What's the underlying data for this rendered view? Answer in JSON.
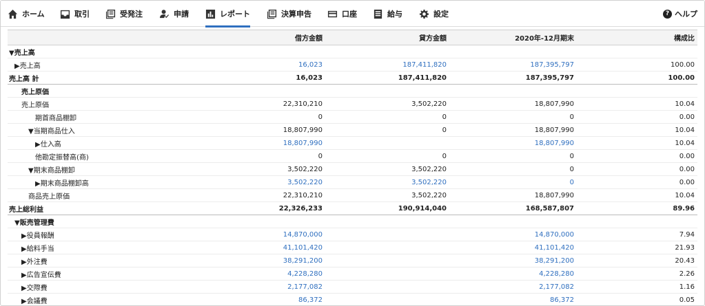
{
  "nav": {
    "items": [
      {
        "label": "ホーム",
        "icon": "home-icon"
      },
      {
        "label": "取引",
        "icon": "inbox-icon"
      },
      {
        "label": "受発注",
        "icon": "document-icon"
      },
      {
        "label": "申請",
        "icon": "user-check-icon"
      },
      {
        "label": "レポート",
        "icon": "bar-chart-icon",
        "active": true
      },
      {
        "label": "決算申告",
        "icon": "document-icon"
      },
      {
        "label": "口座",
        "icon": "credit-card-icon"
      },
      {
        "label": "給与",
        "icon": "list-icon"
      },
      {
        "label": "設定",
        "icon": "gear-icon"
      }
    ],
    "help_label": "ヘルプ",
    "help_icon": "?",
    "accent_color": "#2f6fbf"
  },
  "table": {
    "headers": [
      "",
      "借方金額",
      "貸方金額",
      "2020年-12月期末",
      "構成比"
    ],
    "rows": [
      {
        "name": "▼売上高",
        "level": 0,
        "style": "bold",
        "debit": "",
        "credit": "",
        "period": "",
        "ratio": "",
        "link": false
      },
      {
        "name": "▶売上高",
        "level": 1,
        "style": "",
        "debit": "16,023",
        "credit": "187,411,820",
        "period": "187,395,797",
        "ratio": "100.00",
        "link": true
      },
      {
        "name": "売上高 計",
        "level": 0,
        "style": "total",
        "debit": "16,023",
        "credit": "187,411,820",
        "period": "187,395,797",
        "ratio": "100.00",
        "link": false
      },
      {
        "name": "売上原価",
        "level": 2,
        "style": "bold",
        "debit": "",
        "credit": "",
        "period": "",
        "ratio": "",
        "link": false
      },
      {
        "name": "売上原価",
        "level": 2,
        "style": "",
        "debit": "22,310,210",
        "credit": "3,502,220",
        "period": "18,807,990",
        "ratio": "10.04",
        "link": false
      },
      {
        "name": "期首商品棚卸",
        "level": 4,
        "style": "",
        "debit": "0",
        "credit": "0",
        "period": "0",
        "ratio": "0.00",
        "link": false
      },
      {
        "name": "▼当期商品仕入",
        "level": 3,
        "style": "",
        "debit": "18,807,990",
        "credit": "0",
        "period": "18,807,990",
        "ratio": "10.04",
        "link": false
      },
      {
        "name": "▶仕入高",
        "level": 4,
        "style": "",
        "debit": "18,807,990",
        "credit": "",
        "period": "18,807,990",
        "ratio": "10.04",
        "link": true
      },
      {
        "name": "他勘定振替高(商)",
        "level": 4,
        "style": "",
        "debit": "0",
        "credit": "0",
        "period": "0",
        "ratio": "0.00",
        "link": false
      },
      {
        "name": "▼期末商品棚卸",
        "level": 3,
        "style": "",
        "debit": "3,502,220",
        "credit": "3,502,220",
        "period": "0",
        "ratio": "0.00",
        "link": false
      },
      {
        "name": "▶期末商品棚卸高",
        "level": 4,
        "style": "",
        "debit": "3,502,220",
        "credit": "3,502,220",
        "period": "0",
        "ratio": "0.00",
        "link": true
      },
      {
        "name": "商品売上原価",
        "level": 3,
        "style": "",
        "debit": "22,310,210",
        "credit": "3,502,220",
        "period": "18,807,990",
        "ratio": "10.04",
        "link": false
      },
      {
        "name": "売上総利益",
        "level": 0,
        "style": "total",
        "debit": "22,326,233",
        "credit": "190,914,040",
        "period": "168,587,807",
        "ratio": "89.96",
        "link": false
      },
      {
        "name": "▼販売管理費",
        "level": 1,
        "style": "bold",
        "debit": "",
        "credit": "",
        "period": "",
        "ratio": "",
        "link": false
      },
      {
        "name": "▶役員報酬",
        "level": 2,
        "style": "",
        "debit": "14,870,000",
        "credit": "",
        "period": "14,870,000",
        "ratio": "7.94",
        "link": true
      },
      {
        "name": "▶給料手当",
        "level": 2,
        "style": "",
        "debit": "41,101,420",
        "credit": "",
        "period": "41,101,420",
        "ratio": "21.93",
        "link": true
      },
      {
        "name": "▶外注費",
        "level": 2,
        "style": "",
        "debit": "38,291,200",
        "credit": "",
        "period": "38,291,200",
        "ratio": "20.43",
        "link": true
      },
      {
        "name": "▶広告宣伝費",
        "level": 2,
        "style": "",
        "debit": "4,228,280",
        "credit": "",
        "period": "4,228,280",
        "ratio": "2.26",
        "link": true
      },
      {
        "name": "▶交際費",
        "level": 2,
        "style": "",
        "debit": "2,177,082",
        "credit": "",
        "period": "2,177,082",
        "ratio": "1.16",
        "link": true
      },
      {
        "name": "▶会議費",
        "level": 2,
        "style": "",
        "debit": "86,372",
        "credit": "",
        "period": "86,372",
        "ratio": "0.05",
        "link": true
      }
    ]
  }
}
